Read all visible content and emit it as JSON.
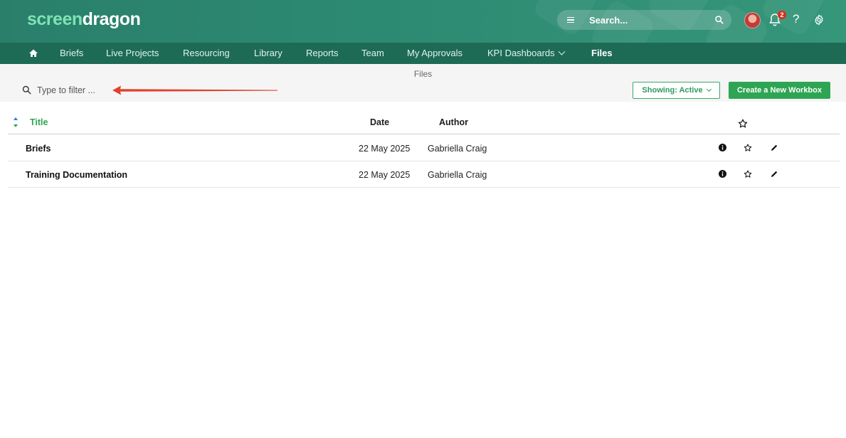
{
  "header": {
    "logo_part1": "screen",
    "logo_part2": "dragon",
    "search_placeholder": "Search...",
    "notification_count": "2",
    "help_label": "?"
  },
  "nav": {
    "items": [
      {
        "label": "Briefs"
      },
      {
        "label": "Live Projects"
      },
      {
        "label": "Resourcing"
      },
      {
        "label": "Library"
      },
      {
        "label": "Reports"
      },
      {
        "label": "Team"
      },
      {
        "label": "My Approvals"
      },
      {
        "label": "KPI Dashboards"
      },
      {
        "label": "Files"
      }
    ],
    "active": "Files"
  },
  "toolbar": {
    "page_label": "Files",
    "filter_placeholder": "Type to filter ...",
    "showing_label": "Showing: Active",
    "create_label": "Create a New Workbox"
  },
  "table": {
    "columns": {
      "title": "Title",
      "date": "Date",
      "author": "Author"
    },
    "rows": [
      {
        "title": "Briefs",
        "date": "22 May 2025",
        "author": "Gabriella Craig"
      },
      {
        "title": "Training Documentation",
        "date": "22 May 2025",
        "author": "Gabriella Craig"
      }
    ]
  },
  "colors": {
    "header_bg": "#2d8a72",
    "nav_bg": "#1e6b55",
    "accent_green": "#2ea553",
    "annotation_arrow": "#e0412c"
  }
}
